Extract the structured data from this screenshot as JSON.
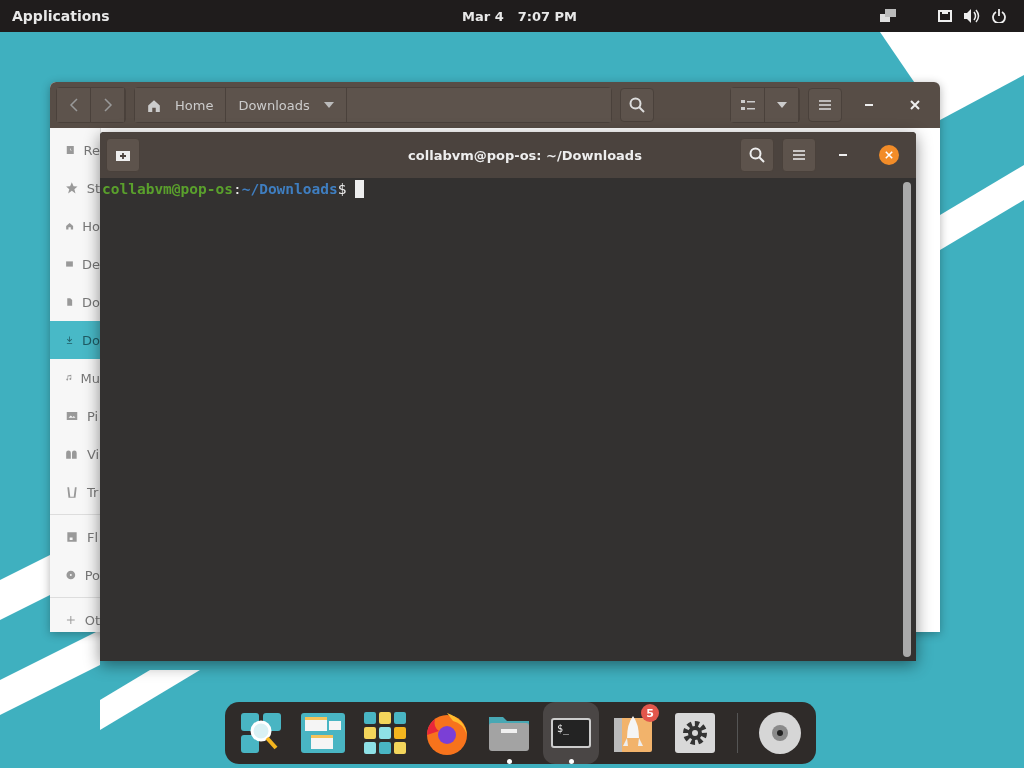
{
  "top_bar": {
    "applications": "Applications",
    "date": "Mar 4",
    "time": "7:07 PM"
  },
  "file_manager": {
    "path": [
      "Home",
      "Downloads"
    ],
    "sidebar_sections": [
      [
        {
          "label": "Re",
          "selected": false
        },
        {
          "label": "St",
          "selected": false
        },
        {
          "label": "Ho",
          "selected": false
        },
        {
          "label": "De",
          "selected": false
        },
        {
          "label": "Do",
          "selected": false
        },
        {
          "label": "Do",
          "selected": true
        },
        {
          "label": "Mu",
          "selected": false
        },
        {
          "label": "Pi",
          "selected": false
        },
        {
          "label": "Vi",
          "selected": false
        },
        {
          "label": "Tr",
          "selected": false
        }
      ],
      [
        {
          "label": "Fl",
          "selected": false
        },
        {
          "label": "Po",
          "selected": false
        }
      ],
      [
        {
          "label": "Ot",
          "selected": false
        }
      ]
    ]
  },
  "terminal": {
    "title": "collabvm@pop-os: ~/Downloads",
    "prompt": {
      "user_host": "collabvm@pop-os",
      "separator": ":",
      "path": "~/Downloads",
      "symbol": "$"
    }
  },
  "dock": [
    {
      "kind": "workspaces",
      "selected": false,
      "running": false
    },
    {
      "kind": "windows",
      "selected": false,
      "running": false
    },
    {
      "kind": "apps",
      "selected": false,
      "running": false
    },
    {
      "kind": "browser",
      "selected": false,
      "running": false
    },
    {
      "kind": "files",
      "selected": false,
      "running": true
    },
    {
      "kind": "terminal",
      "label": "$_",
      "selected": true,
      "running": true
    },
    {
      "kind": "shop",
      "badge": "5",
      "selected": false,
      "running": false
    },
    {
      "kind": "settings",
      "selected": false,
      "running": false
    },
    {
      "kind": "disc",
      "selected": false,
      "running": false
    }
  ]
}
